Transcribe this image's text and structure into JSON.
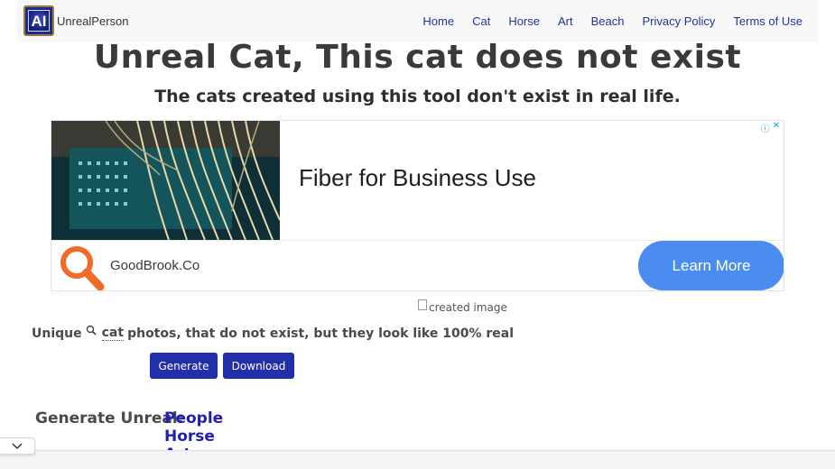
{
  "nav": {
    "logo_text": "AI",
    "brand": "UnrealPerson",
    "links": [
      "Home",
      "Cat",
      "Horse",
      "Art",
      "Beach",
      "Privacy Policy",
      "Terms of Use"
    ]
  },
  "header": {
    "title": "Unreal Cat, This cat does not exist",
    "subtitle": "The cats created using this tool don't exist in real life."
  },
  "ad": {
    "headline": "Fiber for Business Use",
    "domain": "GoodBrook.Co",
    "cta": "Learn More",
    "info_icon": "info-icon",
    "close_icon": "close-icon"
  },
  "image": {
    "alt": "created image"
  },
  "tagline": {
    "before": "Unique",
    "keyword": "cat",
    "after": "photos, that do not exist, but they look like 100% real",
    "icon": "search-icon"
  },
  "actions": {
    "generate": "Generate",
    "download": "Download"
  },
  "generate_unreal": {
    "label": "Generate Unreal:",
    "links": [
      "People",
      "Horse",
      "Art"
    ]
  },
  "colors": {
    "accent": "#2130a8",
    "link": "#1f1fb8",
    "ad_button": "#4a8cf0",
    "ad_magnifier": "#f06a28"
  }
}
